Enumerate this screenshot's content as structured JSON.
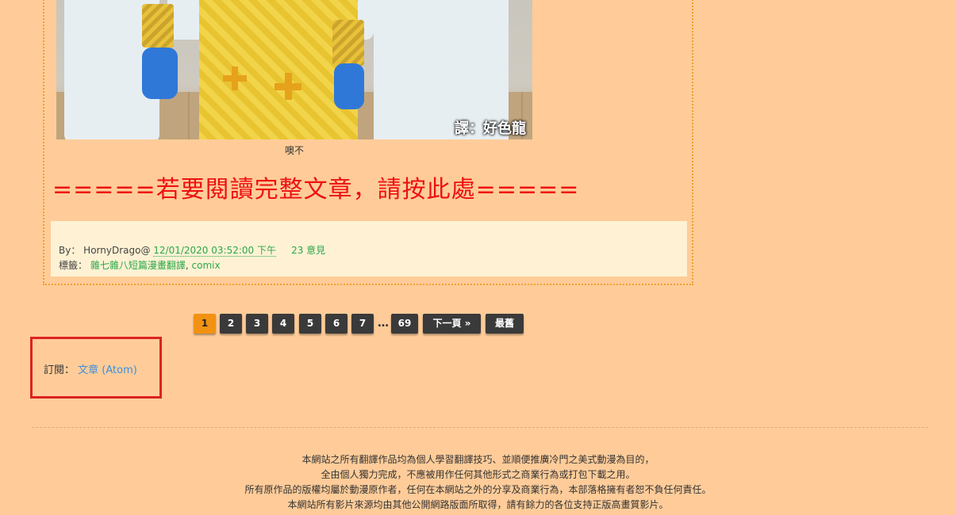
{
  "post": {
    "photo_watermark": "譯：好色龍",
    "caption": "噢不",
    "read_more": "=====若要閱讀完整文章，請按此處=====",
    "meta": {
      "by_label": "By：",
      "author": "HornyDrago",
      "at": "@",
      "datetime": "12/01/2020 03:52:00 下午",
      "comments": "23 意見",
      "tags_label": "標籤：",
      "tags": [
        "雜七雜八短篇漫畫翻譯",
        "comix"
      ],
      "tag_separator": ","
    }
  },
  "pager": {
    "pages": [
      "1",
      "2",
      "3",
      "4",
      "5",
      "6",
      "7"
    ],
    "active_page": "1",
    "ellipsis": "…",
    "last_page_number": "69",
    "next_label": "下一頁 »",
    "last_label": "最舊"
  },
  "subscribe": {
    "label": "訂閱：",
    "link": "文章 (Atom)"
  },
  "disclaimer": [
    "本網站之所有翻譯作品均為個人學習翻譯技巧、並順便推廣冷門之美式動漫為目的，",
    "全由個人獨力完成，不應被用作任何其他形式之商業行為或打包下載之用。",
    "所有原作品的版權均屬於動漫原作者，任何在本網站之外的分享及商業行為，本部落格擁有者恕不負任何責任。",
    "本網站所有影片來源均由其他公開網路版面所取得，請有餘力的各位支持正版高畫質影片。"
  ],
  "colors": {
    "background": "#ffcc99",
    "read_more": "#ee1111",
    "link_green": "#2aa84a",
    "link_blue": "#3b8fe0",
    "page_active": "#f29212",
    "page_button": "#3a3a3a",
    "highlight_border": "#dd2222"
  }
}
